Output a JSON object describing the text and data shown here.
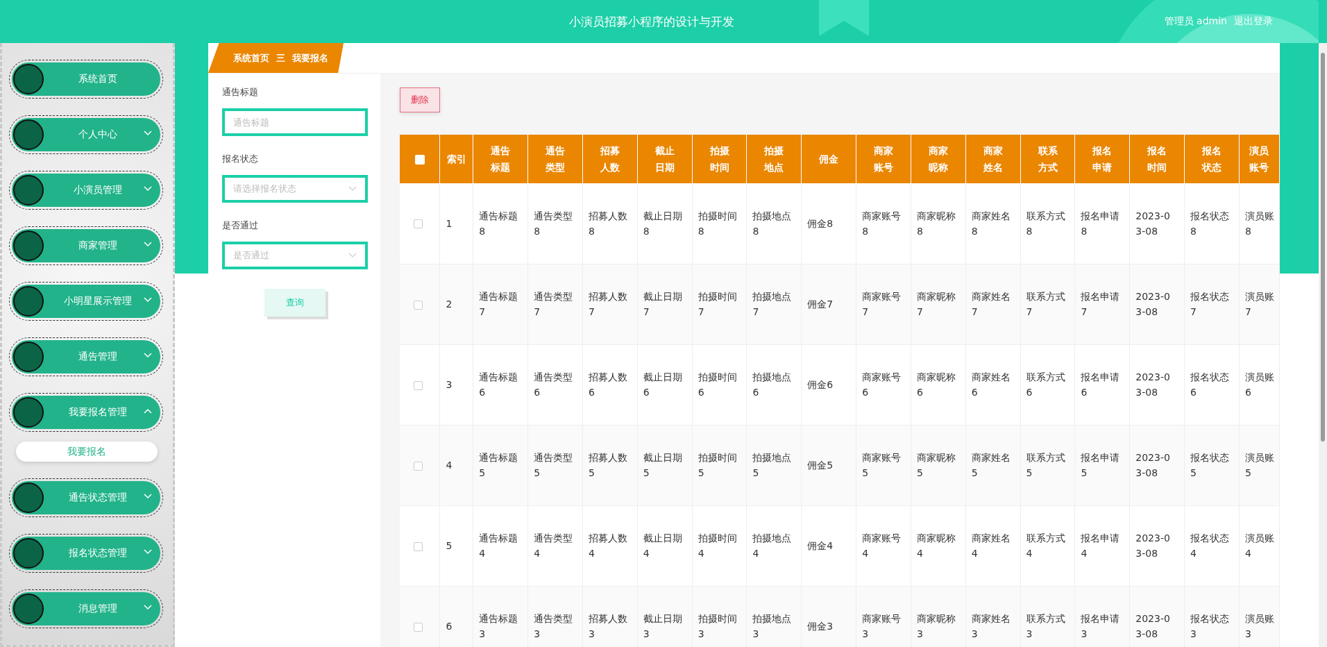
{
  "header": {
    "title": "小演员招募小程序的设计与开发",
    "user": "管理员 admin",
    "logout": "退出登录"
  },
  "sidebar": {
    "items": [
      {
        "kind": "link",
        "label": "系统首页"
      },
      {
        "kind": "menu",
        "label": "个人中心",
        "expanded": false
      },
      {
        "kind": "menu",
        "label": "小演员管理",
        "expanded": false
      },
      {
        "kind": "menu",
        "label": "商家管理",
        "expanded": false
      },
      {
        "kind": "menu",
        "label": "小明星展示管理",
        "expanded": false
      },
      {
        "kind": "menu",
        "label": "通告管理",
        "expanded": false
      },
      {
        "kind": "menu",
        "label": "我要报名管理",
        "expanded": true,
        "children": [
          {
            "label": "我要报名",
            "selected": true
          }
        ]
      },
      {
        "kind": "menu",
        "label": "通告状态管理",
        "expanded": false
      },
      {
        "kind": "menu",
        "label": "报名状态管理",
        "expanded": false
      },
      {
        "kind": "menu",
        "label": "消息管理",
        "expanded": false
      }
    ]
  },
  "breadcrumb": {
    "items": [
      "系统首页",
      "我要报名"
    ],
    "separator": "三"
  },
  "filters": [
    {
      "kind": "input",
      "label": "通告标题",
      "placeholder": "通告标题"
    },
    {
      "kind": "select",
      "label": "报名状态",
      "placeholder": "请选择报名状态"
    },
    {
      "kind": "select",
      "label": "是否通过",
      "placeholder": "是否通过"
    }
  ],
  "search_button": "查询",
  "delete_button": "删除",
  "table": {
    "header_checked": false,
    "columns": [
      "索引",
      "通告标题",
      "通告类型",
      "招募人数",
      "截止日期",
      "拍摄时间",
      "拍摄地点",
      "佣金",
      "商家账号",
      "商家昵称",
      "商家姓名",
      "联系方式",
      "报名申请",
      "报名时间",
      "报名状态",
      "演员账号"
    ],
    "rows": [
      {
        "checked": false,
        "cells": [
          "1",
          "通告标题8",
          "通告类型8",
          "招募人数8",
          "截止日期8",
          "拍摄时间8",
          "拍摄地点8",
          "佣金8",
          "商家账号8",
          "商家昵称8",
          "商家姓名8",
          "联系方式8",
          "报名申请8",
          "2023-03-08",
          "报名状态8",
          "演员账8"
        ]
      },
      {
        "checked": false,
        "cells": [
          "2",
          "通告标题7",
          "通告类型7",
          "招募人数7",
          "截止日期7",
          "拍摄时间7",
          "拍摄地点7",
          "佣金7",
          "商家账号7",
          "商家昵称7",
          "商家姓名7",
          "联系方式7",
          "报名申请7",
          "2023-03-08",
          "报名状态7",
          "演员账7"
        ]
      },
      {
        "checked": false,
        "cells": [
          "3",
          "通告标题6",
          "通告类型6",
          "招募人数6",
          "截止日期6",
          "拍摄时间6",
          "拍摄地点6",
          "佣金6",
          "商家账号6",
          "商家昵称6",
          "商家姓名6",
          "联系方式6",
          "报名申请6",
          "2023-03-08",
          "报名状态6",
          "演员账6"
        ]
      },
      {
        "checked": false,
        "cells": [
          "4",
          "通告标题5",
          "通告类型5",
          "招募人数5",
          "截止日期5",
          "拍摄时间5",
          "拍摄地点5",
          "佣金5",
          "商家账号5",
          "商家昵称5",
          "商家姓名5",
          "联系方式5",
          "报名申请5",
          "2023-03-08",
          "报名状态5",
          "演员账5"
        ]
      },
      {
        "checked": false,
        "cells": [
          "5",
          "通告标题4",
          "通告类型4",
          "招募人数4",
          "截止日期4",
          "拍摄时间4",
          "拍摄地点4",
          "佣金4",
          "商家账号4",
          "商家昵称4",
          "商家姓名4",
          "联系方式4",
          "报名申请4",
          "2023-03-08",
          "报名状态4",
          "演员账4"
        ]
      },
      {
        "checked": false,
        "cells": [
          "6",
          "通告标题3",
          "通告类型3",
          "招募人数3",
          "截止日期3",
          "拍摄时间3",
          "拍摄地点3",
          "佣金3",
          "商家账号3",
          "商家昵称3",
          "商家姓名3",
          "联系方式3",
          "报名申请3",
          "2023-03-08",
          "报名状态3",
          "演员账3"
        ]
      }
    ]
  }
}
